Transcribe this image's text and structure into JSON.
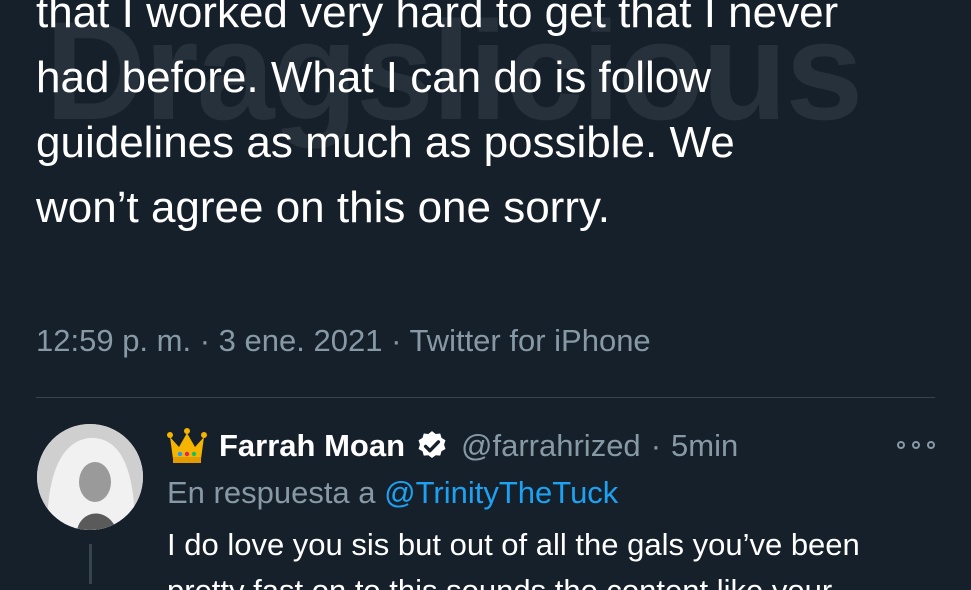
{
  "tweet": {
    "lines": [
      "that I worked very hard to get that I never",
      "had before. What I can do is follow",
      "guidelines as much as possible. We",
      "won’t agree on this one sorry."
    ],
    "time": "12:59 p. m.",
    "separator": "·",
    "date": "3 ene. 2021",
    "source": "Twitter for iPhone"
  },
  "watermark": {
    "text": "Dragslicious"
  },
  "reply": {
    "avatar_icon": "profile-photo",
    "crown_icon": "crown-emoji",
    "name": "Farrah Moan",
    "verified_icon": "verified-badge-icon",
    "handle": "@farrahrized",
    "separator": "·",
    "time": "5min",
    "more_icon": "more-options-icon",
    "replying_prefix": "En respuesta a",
    "replying_to": "@TrinityTheTuck",
    "text_line1": "I do love you sis but out of all the gals you’ve been",
    "text_line2": "pretty fast on to this sounds the content like your"
  },
  "colors": {
    "background": "#15202b",
    "secondary_text": "#8899a6",
    "link": "#1da1f2",
    "divider": "#38444d"
  }
}
